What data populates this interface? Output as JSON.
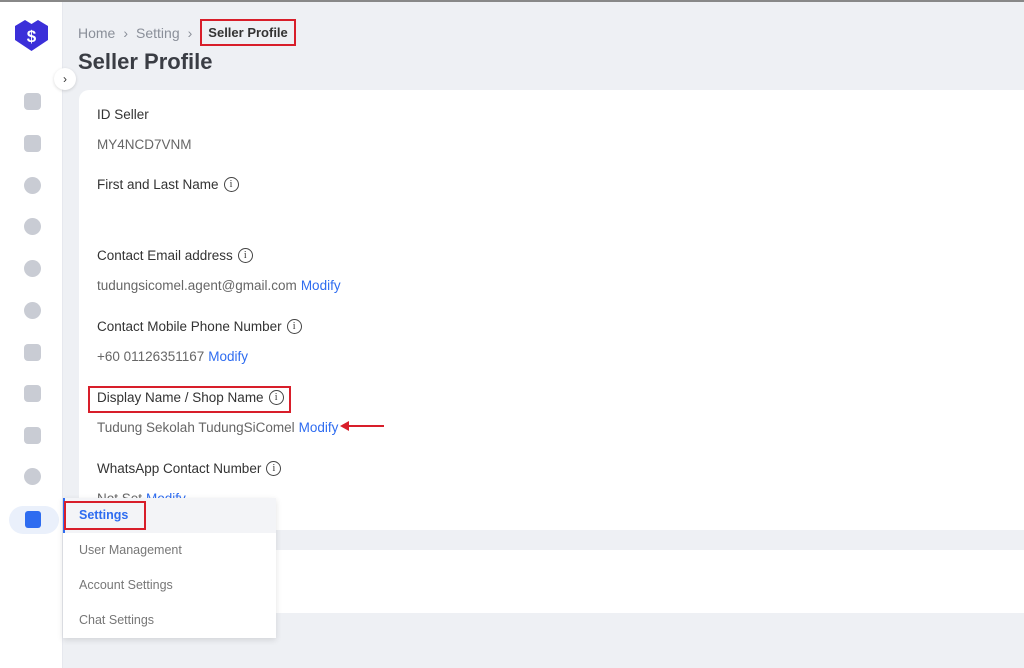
{
  "breadcrumb": [
    "Home",
    "Setting",
    "Seller Profile"
  ],
  "page_title": "Seller Profile",
  "fields": [
    {
      "label": "ID Seller",
      "value": "MY4NCD7VNM"
    },
    {
      "label": "First and Last Name",
      "value": ""
    },
    {
      "label": "Contact Email address",
      "value": "tudungsicomel.agent@gmail.com",
      "action": "Modify"
    },
    {
      "label": "Contact Mobile Phone Number",
      "value": "+60 01126351167",
      "action": "Modify"
    },
    {
      "label": "Display Name / Shop Name",
      "value": "Tudung Sekolah TudungSiComel",
      "action": "Modify"
    },
    {
      "label": "WhatsApp Contact Number",
      "value": "Not Set",
      "action": "Modify"
    }
  ],
  "menu": [
    "Settings",
    "User Management",
    "Account Settings",
    "Chat Settings"
  ],
  "colors": {
    "accent": "#2e6cf0",
    "highlight": "#d81e2a",
    "logo": "#3b2fd9"
  }
}
